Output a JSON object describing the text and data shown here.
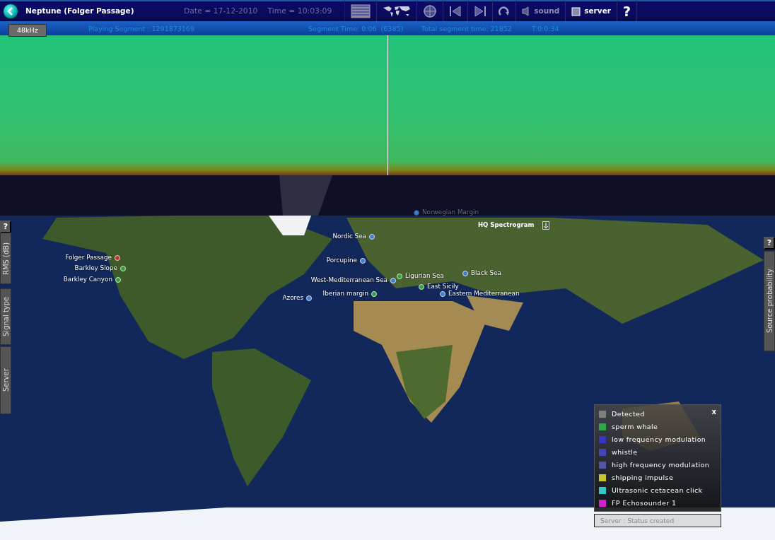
{
  "header": {
    "title": "Neptune (Folger Passage)",
    "date": "Date = 17-12-2010",
    "time": "Time = 10:03:09"
  },
  "toolbar": [
    {
      "kind": "list"
    },
    {
      "kind": "world"
    },
    {
      "kind": "target"
    },
    {
      "kind": "previous"
    },
    {
      "kind": "next"
    },
    {
      "kind": "refresh"
    },
    {
      "kind": "sound",
      "label": "sound",
      "active": false
    },
    {
      "kind": "server",
      "label": "server",
      "active": true
    },
    {
      "kind": "help",
      "label": "?"
    }
  ],
  "playback": {
    "segment": "Playing Segment : 1291873169",
    "segment_time": "Segment Time: 0:06  (6385)",
    "total": "Total segment time: 21852",
    "timer": "T:0:0:34"
  },
  "sample_rate": "48kHz",
  "stations": [
    {
      "name": "Norwegian Margin",
      "color": "#3b7fd6",
      "faded": true
    },
    {
      "name": "Nordic Sea",
      "color": "#3b7fd6",
      "faded": false
    },
    {
      "name": "Folger Passage",
      "color": "#c0302a",
      "faded": false
    },
    {
      "name": "Porcupine",
      "color": "#3b7fd6",
      "faded": false
    },
    {
      "name": "Barkley Slope",
      "color": "#2fa336",
      "faded": false
    },
    {
      "name": "Black Sea",
      "color": "#3b7fd6",
      "faded": false
    },
    {
      "name": "Ligurian Sea",
      "color": "#2fa336",
      "faded": false
    },
    {
      "name": "Barkley Canyon",
      "color": "#2fa336",
      "faded": false
    },
    {
      "name": "West-Mediterranean Sea",
      "color": "#3b7fd6",
      "faded": false
    },
    {
      "name": "East Sicily",
      "color": "#2fa336",
      "faded": false
    },
    {
      "name": "Iberian margin",
      "color": "#2fa336",
      "faded": false
    },
    {
      "name": "Eastern Mediterranean",
      "color": "#3b7fd6",
      "faded": false
    },
    {
      "name": "Azores",
      "color": "#3b7fd6",
      "faded": false
    }
  ],
  "hq_spectrogram": "HQ Spectrogram",
  "left_tabs": [
    "?",
    "RMS (dB)",
    "Signal type",
    "Server"
  ],
  "right_tabs": [
    "?",
    "Source probability"
  ],
  "legend": {
    "close": "x",
    "items": [
      {
        "label": "Detected",
        "color": "#7f7f7f"
      },
      {
        "label": "sperm whale",
        "color": "#2fa84a"
      },
      {
        "label": "low frequency modulation",
        "color": "#3535c8"
      },
      {
        "label": "whistle",
        "color": "#4545b8"
      },
      {
        "label": "high frequency modulation",
        "color": "#5555a8"
      },
      {
        "label": "shipping impulse",
        "color": "#c8c830"
      },
      {
        "label": "Ultrasonic cetacean click",
        "color": "#30c8c8"
      },
      {
        "label": "FP Echosounder 1",
        "color": "#d020d0"
      }
    ]
  },
  "status": "Server : Status created"
}
